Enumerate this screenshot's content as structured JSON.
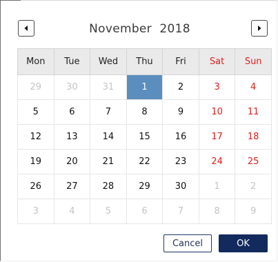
{
  "header": {
    "month": "November",
    "year": "2018"
  },
  "nav": {
    "prev_icon": "chevron-left-icon",
    "next_icon": "chevron-right-icon"
  },
  "weekdays": [
    "Mon",
    "Tue",
    "Wed",
    "Thu",
    "Fri",
    "Sat",
    "Sun"
  ],
  "weeks": [
    [
      {
        "day": "29",
        "state": "other"
      },
      {
        "day": "30",
        "state": "other"
      },
      {
        "day": "31",
        "state": "other"
      },
      {
        "day": "1",
        "state": "selected"
      },
      {
        "day": "2",
        "state": "current"
      },
      {
        "day": "3",
        "state": "current"
      },
      {
        "day": "4",
        "state": "current"
      }
    ],
    [
      {
        "day": "5",
        "state": "current"
      },
      {
        "day": "6",
        "state": "current"
      },
      {
        "day": "7",
        "state": "current"
      },
      {
        "day": "8",
        "state": "current"
      },
      {
        "day": "9",
        "state": "current"
      },
      {
        "day": "10",
        "state": "current"
      },
      {
        "day": "11",
        "state": "current"
      }
    ],
    [
      {
        "day": "12",
        "state": "current"
      },
      {
        "day": "13",
        "state": "current"
      },
      {
        "day": "14",
        "state": "current"
      },
      {
        "day": "15",
        "state": "current"
      },
      {
        "day": "16",
        "state": "current"
      },
      {
        "day": "17",
        "state": "current"
      },
      {
        "day": "18",
        "state": "current"
      }
    ],
    [
      {
        "day": "19",
        "state": "current"
      },
      {
        "day": "20",
        "state": "current"
      },
      {
        "day": "21",
        "state": "current"
      },
      {
        "day": "22",
        "state": "current"
      },
      {
        "day": "23",
        "state": "current"
      },
      {
        "day": "24",
        "state": "current"
      },
      {
        "day": "25",
        "state": "current"
      }
    ],
    [
      {
        "day": "26",
        "state": "current"
      },
      {
        "day": "27",
        "state": "current"
      },
      {
        "day": "28",
        "state": "current"
      },
      {
        "day": "29",
        "state": "current"
      },
      {
        "day": "30",
        "state": "current"
      },
      {
        "day": "1",
        "state": "other"
      },
      {
        "day": "2",
        "state": "other"
      }
    ],
    [
      {
        "day": "3",
        "state": "other"
      },
      {
        "day": "4",
        "state": "other"
      },
      {
        "day": "5",
        "state": "other"
      },
      {
        "day": "6",
        "state": "other"
      },
      {
        "day": "7",
        "state": "other"
      },
      {
        "day": "8",
        "state": "other"
      },
      {
        "day": "9",
        "state": "other"
      }
    ]
  ],
  "buttons": {
    "cancel": "Cancel",
    "ok": "OK"
  },
  "colors": {
    "weekend": "#e21b1b",
    "selected_bg": "#5b8ebf",
    "header_bg": "#eaeaea",
    "ok_bg": "#132a5e",
    "other_month": "#c4c4c4"
  }
}
